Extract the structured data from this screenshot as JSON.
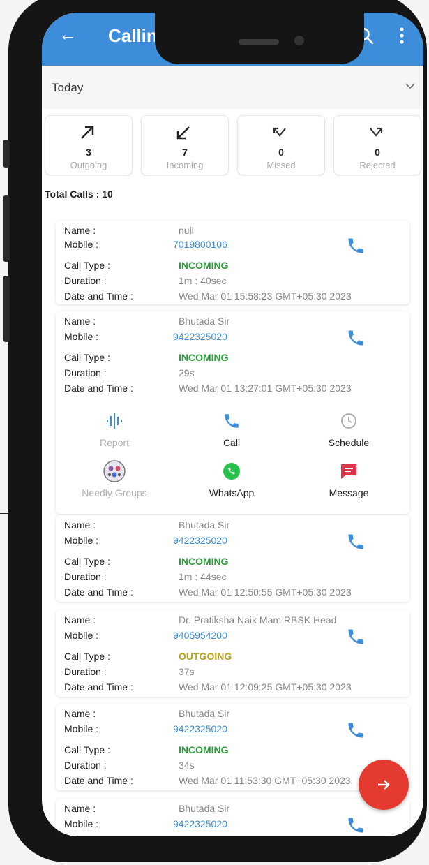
{
  "appbar": {
    "title": "Calling History",
    "back_icon": "arrow-left-icon",
    "search_icon": "search-icon",
    "more_icon": "more-vertical-icon"
  },
  "filter": {
    "selected": "Today"
  },
  "stats": [
    {
      "count": "3",
      "label": "Outgoing",
      "icon": "arrow-up-right-icon"
    },
    {
      "count": "7",
      "label": "Incoming",
      "icon": "arrow-down-left-icon"
    },
    {
      "count": "0",
      "label": "Missed",
      "icon": "missed-call-icon"
    },
    {
      "count": "0",
      "label": "Rejected",
      "icon": "rejected-call-icon"
    }
  ],
  "total_calls": "Total Calls : 10",
  "field_labels": {
    "name": "Name :",
    "mobile": "Mobile :",
    "call_type": "Call Type :",
    "duration": "Duration :",
    "date_time": "Date and Time :"
  },
  "calls": [
    {
      "name": "null",
      "mobile": "7019800106",
      "type": "INCOMING",
      "duration": "1m : 40sec",
      "datetime": "Wed Mar 01 15:58:23 GMT+05:30 2023"
    },
    {
      "name": "Bhutada Sir",
      "mobile": "9422325020",
      "type": "INCOMING",
      "duration": "29s",
      "datetime": "Wed Mar 01 13:27:01 GMT+05:30 2023"
    },
    {
      "name": "Bhutada Sir",
      "mobile": "9422325020",
      "type": "INCOMING",
      "duration": "1m : 44sec",
      "datetime": "Wed Mar 01 12:50:55 GMT+05:30 2023"
    },
    {
      "name": "Dr. Pratiksha Naik Mam RBSK Head",
      "mobile": "9405954200",
      "type": "OUTGOING",
      "duration": "37s",
      "datetime": "Wed Mar 01 12:09:25 GMT+05:30 2023"
    },
    {
      "name": "Bhutada Sir",
      "mobile": "9422325020",
      "type": "INCOMING",
      "duration": "34s",
      "datetime": "Wed Mar 01 11:53:30 GMT+05:30 2023"
    },
    {
      "name": "Bhutada Sir",
      "mobile": "9422325020"
    }
  ],
  "actions": [
    {
      "label": "Report",
      "icon": "waveform-icon",
      "color": "#b0b0b0"
    },
    {
      "label": "Call",
      "icon": "phone-icon",
      "color": "#222222"
    },
    {
      "label": "Schedule",
      "icon": "clock-icon",
      "color": "#222222"
    },
    {
      "label": "Needly Groups",
      "icon": "group-logo-icon",
      "color": "#b0b0b0"
    },
    {
      "label": "WhatsApp",
      "icon": "whatsapp-icon",
      "color": "#222222"
    },
    {
      "label": "Message",
      "icon": "message-icon",
      "color": "#222222"
    }
  ],
  "colors": {
    "primary": "#3d8ddb",
    "incoming": "#2e9a3a",
    "outgoing": "#b8a51c",
    "fab": "#e53a2f"
  }
}
